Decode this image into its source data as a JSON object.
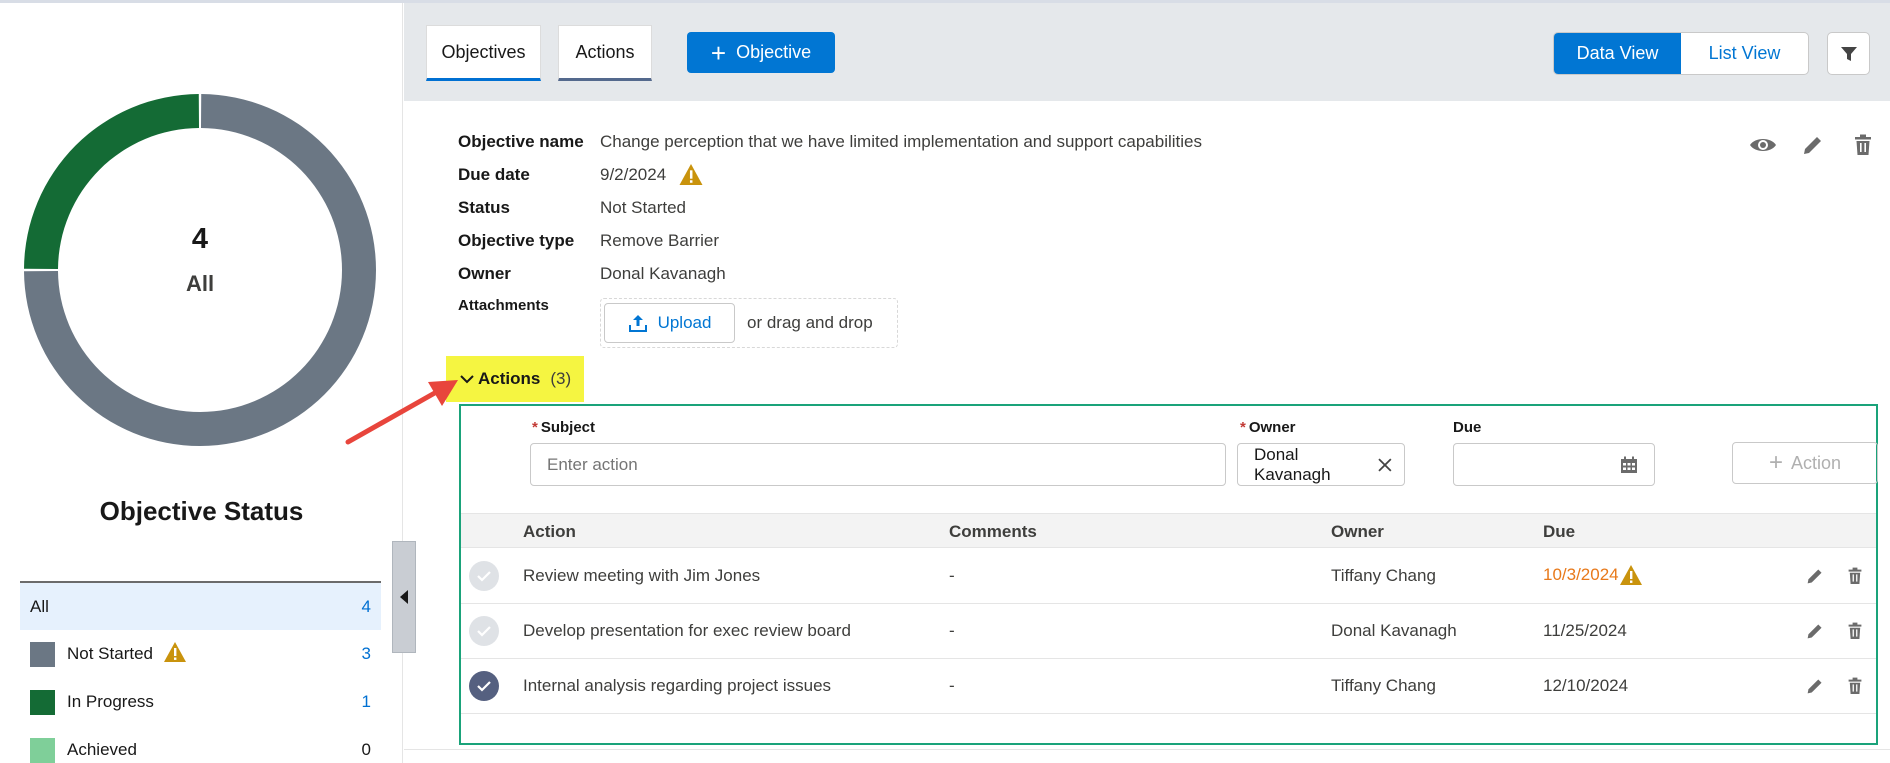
{
  "left_panel": {
    "donut_count": "4",
    "donut_label": "All",
    "title": "Objective Status",
    "segments": [
      {
        "status": "Not Started",
        "value": 3,
        "color": "#6b7784"
      },
      {
        "status": "In Progress",
        "value": 1,
        "color": "#146b35"
      }
    ],
    "legend": [
      {
        "label": "All",
        "count": "4",
        "color": null,
        "warning": false
      },
      {
        "label": "Not Started",
        "count": "3",
        "color": "#6b7784",
        "warning": true
      },
      {
        "label": "In Progress",
        "count": "1",
        "color": "#146b35",
        "warning": false
      },
      {
        "label": "Achieved",
        "count": "0",
        "color": "#7fcf99",
        "warning": false
      }
    ]
  },
  "header": {
    "tabs": [
      {
        "label": "Objectives",
        "active": true
      },
      {
        "label": "Actions",
        "active": false
      }
    ],
    "new_objective_label": "Objective",
    "view_toggle": {
      "data_view": "Data View",
      "list_view": "List View",
      "selected": "Data View"
    }
  },
  "objective": {
    "labels": {
      "name": "Objective name",
      "due_date": "Due date",
      "status": "Status",
      "type": "Objective type",
      "owner": "Owner",
      "attachments": "Attachments"
    },
    "name": "Change perception that we have limited implementation and support capabilities",
    "due_date": "9/2/2024",
    "status": "Not Started",
    "type": "Remove Barrier",
    "owner": "Donal Kavanagh",
    "upload_label": "Upload",
    "drag_text": "or drag and drop"
  },
  "actions_section": {
    "title": "Actions",
    "count": "(3)",
    "form": {
      "subject_label": "Subject",
      "subject_placeholder": "Enter action",
      "owner_label": "Owner",
      "owner_value": "Donal Kavanagh",
      "due_label": "Due",
      "add_label": "Action"
    },
    "columns": [
      "Action",
      "Comments",
      "Owner",
      "Due"
    ],
    "rows": [
      {
        "action": "Review meeting with Jim Jones",
        "comments": "-",
        "owner": "Tiffany Chang",
        "due": "10/3/2024",
        "overdue": true,
        "done": false
      },
      {
        "action": "Develop presentation for exec review board",
        "comments": "-",
        "owner": "Donal Kavanagh",
        "due": "11/25/2024",
        "overdue": false,
        "done": false
      },
      {
        "action": "Internal analysis regarding project issues",
        "comments": "-",
        "owner": "Tiffany Chang",
        "due": "12/10/2024",
        "overdue": false,
        "done": true
      }
    ]
  },
  "colors": {
    "brand_blue": "#0176d3",
    "highlight_yellow": "#f5f541",
    "panel_border": "#1aa37a",
    "warning": "#c9930d",
    "overdue": "#e8791a",
    "annotation_arrow": "#e8453c"
  }
}
